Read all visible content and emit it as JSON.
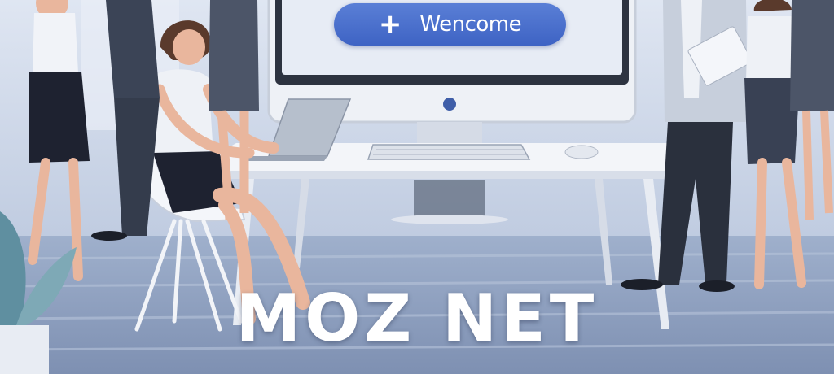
{
  "banner": {
    "icon": "plus-icon",
    "label": "Wencome"
  },
  "headline": "MOZ NET",
  "colors": {
    "background": "#c9d3e6",
    "banner_blue": "#4a6fcf",
    "monitor_frame": "#2d3340",
    "desk": "#f3f5f9",
    "floor": "#8a99b8"
  }
}
